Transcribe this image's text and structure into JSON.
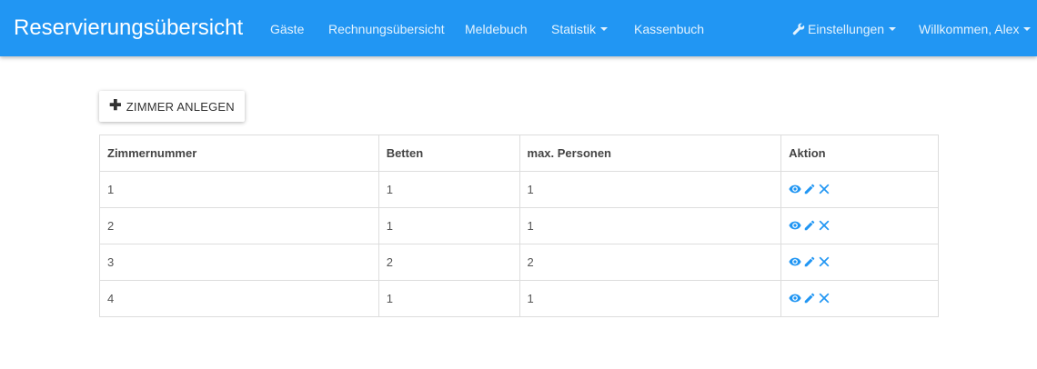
{
  "app": {
    "title": "Reservierungsübersicht"
  },
  "nav": {
    "items": [
      {
        "label": "Gäste"
      },
      {
        "label": "Rechnungsübersicht"
      },
      {
        "label": "Meldebuch"
      },
      {
        "label": "Statistik"
      },
      {
        "label": "Kassenbuch"
      }
    ],
    "settings_label": "Einstellungen",
    "user_label": "Willkommen, Alex"
  },
  "actions": {
    "add_room_label": "ZIMMER ANLEGEN"
  },
  "table": {
    "headers": [
      "Zimmernummer",
      "Betten",
      "max. Personen",
      "Aktion"
    ],
    "rows": [
      {
        "zimmernummer": "1",
        "betten": "1",
        "max_personen": "1"
      },
      {
        "zimmernummer": "2",
        "betten": "1",
        "max_personen": "1"
      },
      {
        "zimmernummer": "3",
        "betten": "2",
        "max_personen": "2"
      },
      {
        "zimmernummer": "4",
        "betten": "1",
        "max_personen": "1"
      }
    ],
    "action_icons": [
      "eye-icon",
      "pencil-icon",
      "close-icon"
    ]
  },
  "colors": {
    "navbar": "#2196f3",
    "icon": "#2196f3",
    "text": "#333333"
  }
}
